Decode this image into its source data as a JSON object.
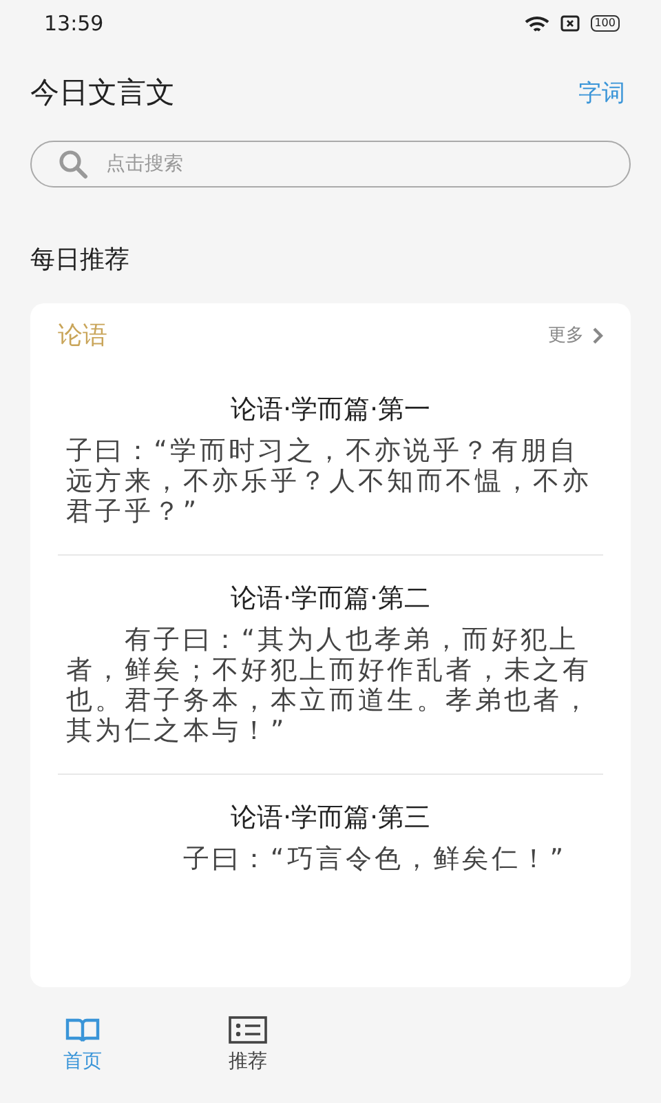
{
  "status_bar": {
    "time": "13:59",
    "battery": "100"
  },
  "header": {
    "title": "今日文言文",
    "action": "字词"
  },
  "search": {
    "placeholder": "点击搜索"
  },
  "section_title": "每日推荐",
  "card": {
    "category": "论语",
    "more": "更多",
    "passages": [
      {
        "title": "论语·学而篇·第一",
        "text": "子曰：“学而时习之，不亦说乎？有朋自远方来，不亦乐乎？人不知而不愠，不亦君子乎？”"
      },
      {
        "title": "论语·学而篇·第二",
        "text": "　　有子曰：“其为人也孝弟，而好犯上者，鲜矣；不好犯上而好作乱者，未之有也。君子务本，本立而道生。孝弟也者，其为仁之本与！”"
      },
      {
        "title": "论语·学而篇·第三",
        "text": "　　　　子曰：“巧言令色，鲜矣仁！”"
      }
    ]
  },
  "tabs": [
    {
      "label": "首页",
      "kind": "book",
      "selected": true
    },
    {
      "label": "推荐",
      "kind": "list",
      "selected": false
    }
  ]
}
